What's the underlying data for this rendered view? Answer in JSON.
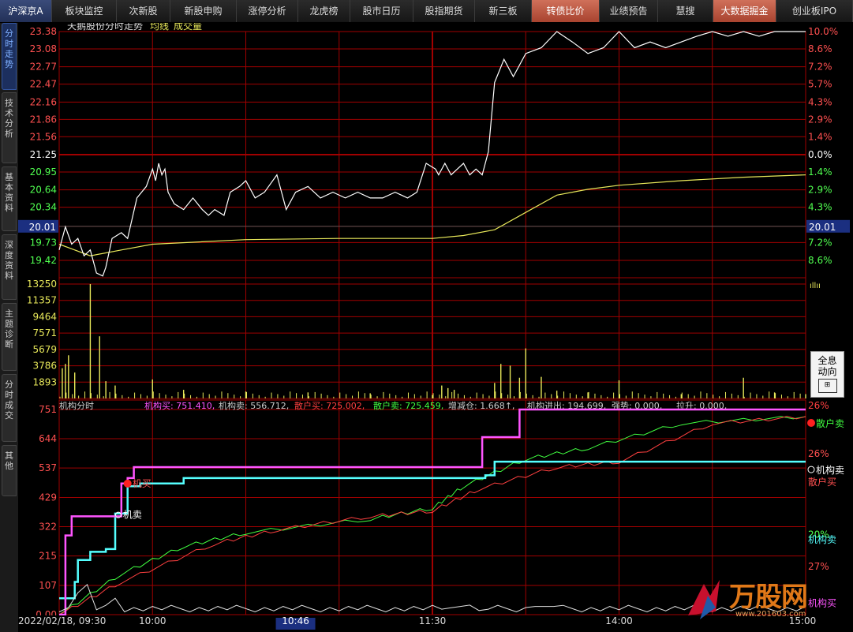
{
  "topbar": {
    "tabs": [
      "沪深京A",
      "板块监控",
      "次新股",
      "新股申购",
      "涨停分析",
      "龙虎榜",
      "股市日历",
      "股指期货",
      "新三板",
      "转债比价",
      "业绩预告",
      "慧搜",
      "大数据掘金",
      "创业板IPO"
    ],
    "highlighted": [
      "转债比价",
      "大数据掘金"
    ]
  },
  "sidebar": {
    "items": [
      "分时走势",
      "技术分析",
      "基本资料",
      "深度资料",
      "主题诊断",
      "分时成交",
      "其他"
    ],
    "active": "分时走势"
  },
  "price_panel": {
    "title": "天鹅股份分时走势",
    "avg_label": "均线",
    "volume_label": "成交量",
    "price_ticks": [
      "23.38",
      "23.08",
      "22.77",
      "22.47",
      "22.16",
      "21.86",
      "21.56",
      "21.25",
      "20.95",
      "20.64",
      "20.34",
      "20.01",
      "19.73",
      "19.42"
    ],
    "percent_ticks": [
      "10.0%",
      "8.6%",
      "7.2%",
      "5.7%",
      "4.3%",
      "2.9%",
      "1.4%",
      "0.0%",
      "1.4%",
      "2.9%",
      "4.3%",
      "5.7%",
      "7.2%",
      "8.6%"
    ],
    "cursor_price": "20.01",
    "prev_close": 21.25
  },
  "volume_panel": {
    "ticks": [
      "13250",
      "11357",
      "9464",
      "7571",
      "5679",
      "3786",
      "1893"
    ]
  },
  "inst_panel": {
    "header": {
      "name": "机构分时",
      "inst_buy": "机构买: 751.410,",
      "inst_sell": "机构卖: 556.712,",
      "retail_buy": "散户买: 725.002,",
      "retail_sell": "散户卖: 725.459,",
      "pos_change": "增减仓: 1.668↑,",
      "inst_net": "机构进出: 194.699,",
      "strength": "强势: 0.000,",
      "lift": "拉升: 0.000,"
    },
    "ticks": [
      "751",
      "644",
      "537",
      "429",
      "322",
      "215",
      "107",
      "0.00"
    ],
    "right_ticks": [
      "26%",
      "26%",
      "20%",
      "27%"
    ],
    "right_labels": [
      "散户卖",
      "机构卖",
      "散户买",
      "机构卖",
      "机构买"
    ],
    "marker_buy": "机买",
    "marker_sell": "机卖"
  },
  "time_axis": {
    "date_time": "2022/02/18, 09:30",
    "labels": [
      "10:00",
      "10:46",
      "11:30",
      "14:00",
      "15:00"
    ]
  },
  "quick_button": {
    "line1": "全息",
    "line2": "动向"
  },
  "watermark": {
    "text": "万股网",
    "url": "www.201603.com"
  },
  "colors": {
    "grid": "#a00000",
    "price": "#ffffff",
    "avg": "#e8e85a",
    "up": "#ff5050",
    "down": "#50ff50",
    "inst_buy": "#ff55ff",
    "inst_sell": "#55ffff",
    "retail_buy": "#ff4040",
    "retail_sell": "#40ff40",
    "volume": "#e8e85a"
  },
  "chart_data": {
    "type": "line",
    "title": "天鹅股份分时走势",
    "xlabel": "",
    "ylabel": "",
    "ylim": [
      19.12,
      23.38
    ],
    "prev_close": 21.25,
    "series": [
      {
        "name": "价格",
        "x": [
          0,
          1,
          2,
          4,
          6,
          8,
          10,
          12,
          14,
          15,
          17,
          20,
          22,
          25,
          28,
          30,
          31,
          32,
          33,
          34,
          35,
          37,
          40,
          43,
          46,
          48,
          50,
          53,
          55,
          58,
          60,
          63,
          66,
          70,
          73,
          76,
          80,
          84,
          88,
          92,
          96,
          100,
          104,
          108,
          112,
          115,
          118,
          121,
          122,
          124,
          126,
          128,
          130,
          132,
          134,
          136,
          138,
          140,
          143,
          146,
          150,
          155,
          160,
          165,
          170,
          175,
          180,
          185,
          190,
          195,
          200,
          205,
          210,
          215,
          220,
          225,
          230,
          235,
          240
        ],
        "y": [
          19.6,
          19.8,
          20.0,
          19.7,
          19.8,
          19.5,
          19.6,
          19.2,
          19.15,
          19.3,
          19.8,
          19.9,
          19.8,
          20.5,
          20.7,
          21.0,
          20.8,
          21.1,
          20.9,
          21.0,
          20.6,
          20.4,
          20.3,
          20.5,
          20.3,
          20.2,
          20.3,
          20.2,
          20.6,
          20.7,
          20.8,
          20.5,
          20.6,
          20.9,
          20.3,
          20.6,
          20.7,
          20.5,
          20.6,
          20.5,
          20.6,
          20.5,
          20.5,
          20.6,
          20.5,
          20.6,
          21.1,
          21.0,
          20.9,
          21.1,
          20.9,
          21.0,
          21.1,
          20.9,
          21.0,
          20.9,
          21.3,
          22.5,
          22.9,
          22.6,
          23.0,
          23.1,
          23.38,
          23.2,
          23.0,
          23.1,
          23.38,
          23.1,
          23.2,
          23.1,
          23.2,
          23.3,
          23.38,
          23.3,
          23.38,
          23.3,
          23.38,
          23.38,
          23.38
        ]
      },
      {
        "name": "均线",
        "x": [
          0,
          5,
          10,
          20,
          30,
          60,
          90,
          120,
          130,
          140,
          150,
          160,
          170,
          180,
          200,
          220,
          240
        ],
        "y": [
          19.7,
          19.6,
          19.5,
          19.6,
          19.7,
          19.78,
          19.8,
          19.8,
          19.85,
          19.95,
          20.25,
          20.55,
          20.65,
          20.72,
          20.8,
          20.86,
          20.9
        ]
      },
      {
        "name": "成交量",
        "x": [
          1,
          2,
          3,
          5,
          10,
          13,
          15,
          18,
          30,
          40,
          60,
          80,
          100,
          120,
          123,
          125,
          127,
          140,
          142,
          145,
          148,
          150,
          155,
          160,
          170,
          180,
          200,
          220,
          230,
          240
        ],
        "y": [
          3500,
          4000,
          5000,
          3000,
          13250,
          7200,
          2000,
          1500,
          2200,
          1000,
          800,
          700,
          600,
          400,
          1500,
          1200,
          1000,
          1800,
          4000,
          3800,
          2400,
          5800,
          2500,
          900,
          700,
          2100,
          500,
          2400,
          700,
          500
        ]
      }
    ]
  }
}
